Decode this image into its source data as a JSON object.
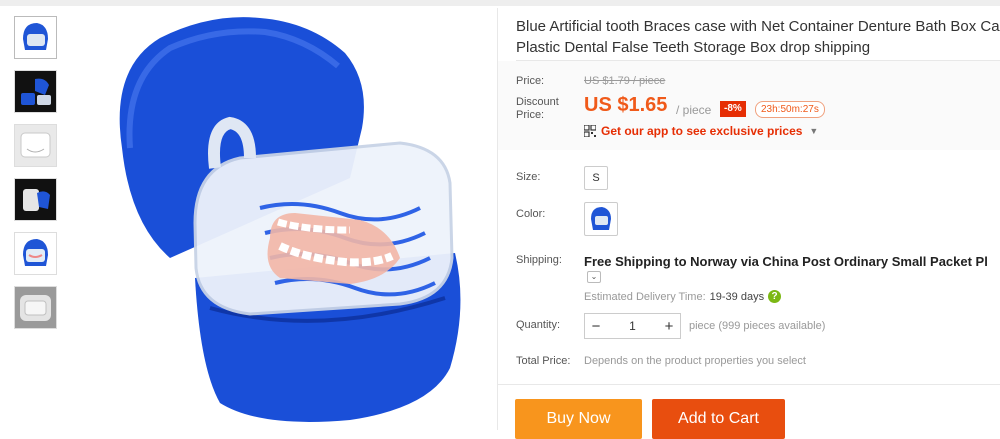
{
  "product": {
    "title_line1": "Blue Artificial tooth Braces case with Net Container Denture Bath Box Case",
    "title_line2": "Plastic Dental False Teeth Storage Box drop shipping"
  },
  "price": {
    "label": "Price:",
    "original": "US $1.79 / piece",
    "discount_label_line1": "Discount",
    "discount_label_line2": "Price:",
    "current": "US $1.65",
    "unit": "/ piece",
    "discount_badge": "-8%",
    "countdown": "23h:50m:27s",
    "app_promo": "Get our app to see exclusive prices"
  },
  "options": {
    "size_label": "Size:",
    "size_value": "S",
    "color_label": "Color:"
  },
  "shipping": {
    "label": "Shipping:",
    "text": "Free Shipping to Norway via China Post Ordinary Small Packet Pl",
    "toggle": "⌄",
    "eta_label": "Estimated Delivery Time:",
    "eta_value": "19-39 days",
    "help": "?"
  },
  "quantity": {
    "label": "Quantity:",
    "minus": "−",
    "value": "1",
    "plus": "+",
    "note": "piece (999 pieces available)"
  },
  "total": {
    "label": "Total Price:",
    "note": "Depends on the product properties you select"
  },
  "actions": {
    "buy_now": "Buy Now",
    "add_to_cart": "Add to Cart"
  },
  "colors": {
    "price": "#f05a1a",
    "buy_now": "#f8951d",
    "add_to_cart": "#e84e0f",
    "badge": "#e62e04",
    "product_blue": "#1a4fd8"
  },
  "icons": [
    "qr-code-icon",
    "caret-down-icon",
    "help-icon",
    "chevron-down-icon"
  ]
}
